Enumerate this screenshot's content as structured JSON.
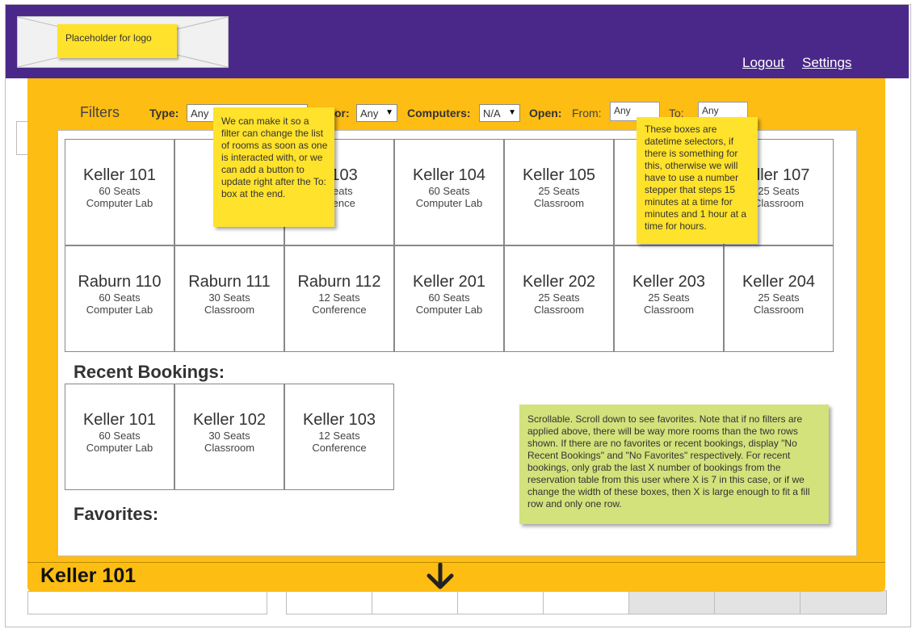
{
  "header": {
    "logo_note": "Placeholder for logo",
    "logout_label": "Logout",
    "settings_label": "Settings",
    "bg_color": "#4a2889"
  },
  "filters": {
    "title": "Filters",
    "type_label": "Type:",
    "type_value": "Any",
    "floor_label": "or:",
    "floor_value": "Any",
    "computers_label": "Computers:",
    "computers_value": "N/A",
    "open_label": "Open:",
    "from_label": "From:",
    "from_value": "Any",
    "to_label": "To:",
    "to_value": "Any"
  },
  "rooms": [
    {
      "name": "Keller 101",
      "seats": "60 Seats",
      "kind": "Computer Lab"
    },
    {
      "name": "Ke",
      "seats": "3",
      "kind": "Cl"
    },
    {
      "name": "r 103",
      "seats": "Seats",
      "kind": "erence"
    },
    {
      "name": "Keller 104",
      "seats": "60 Seats",
      "kind": "Computer Lab"
    },
    {
      "name": "Keller 105",
      "seats": "25 Seats",
      "kind": "Classroom"
    },
    {
      "name": "K",
      "seats": "",
      "kind": ""
    },
    {
      "name": "eller 107",
      "seats": "25 Seats",
      "kind": "Classroom"
    },
    {
      "name": "Raburn 110",
      "seats": "60 Seats",
      "kind": "Computer Lab"
    },
    {
      "name": "Raburn 111",
      "seats": "30 Seats",
      "kind": "Classroom"
    },
    {
      "name": "Raburn 112",
      "seats": "12 Seats",
      "kind": "Conference"
    },
    {
      "name": "Keller 201",
      "seats": "60 Seats",
      "kind": "Computer Lab"
    },
    {
      "name": "Keller 202",
      "seats": "25 Seats",
      "kind": "Classroom"
    },
    {
      "name": "Keller 203",
      "seats": "25 Seats",
      "kind": "Classroom"
    },
    {
      "name": "Keller 204",
      "seats": "25 Seats",
      "kind": "Classroom"
    }
  ],
  "recent": {
    "title": "Recent Bookings:",
    "items": [
      {
        "name": "Keller 101",
        "seats": "60 Seats",
        "kind": "Computer Lab"
      },
      {
        "name": "Keller 102",
        "seats": "30 Seats",
        "kind": "Classroom"
      },
      {
        "name": "Keller 103",
        "seats": "12 Seats",
        "kind": "Conference"
      }
    ]
  },
  "favorites": {
    "title": "Favorites:"
  },
  "notes": {
    "filter_note": "We can make it so a filter can change the list of rooms as soon as one is interacted with, or we can add a button to update right after the To: box at the end.",
    "datetime_note": "These boxes are datetime selectors, if there is something for this, otherwise we will have to use a number stepper that steps 15 minutes at a time for minutes and 1 hour at a time for hours.",
    "scroll_note": "Scrollable. Scroll down to see favorites. Note that if no filters are applied above, there will be way more rooms than the two rows shown. If there are no favorites or recent bookings, display \"No Recent Bookings\" and \"No Favorites\" respectively. For recent bookings, only grab the last X number of bookings from the reservation table from this user where X is 7 in this case, or if we change the width of these boxes, then X is large enough to fit a fill row and only one row."
  },
  "footer": {
    "title": "Keller 101"
  },
  "colors": {
    "modal": "#fdbd13",
    "sticky_yellow": "#ffe22b",
    "sticky_green": "#d3e27b"
  }
}
